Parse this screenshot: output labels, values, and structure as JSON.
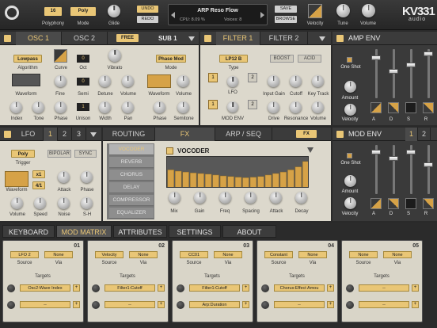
{
  "top": {
    "polyphony_label": "Polyphony",
    "polyphony_value": "16",
    "mode_label": "Mode",
    "mode_value": "Poly",
    "glide_label": "Glide",
    "undo": "UNDO",
    "redo": "REDO",
    "preset_name": "ARP Reso Flow",
    "cpu": "CPU:  8.09 %",
    "voices": "Voices: 8",
    "save": "SAVE",
    "browse": "BROWSE",
    "velocity": "Velocity",
    "tune": "Tune",
    "volume": "Volume",
    "logo": "KV331",
    "logo_sub": "audio"
  },
  "osc": {
    "tab1": "OSC 1",
    "tab2": "OSC 2",
    "free": "FREE",
    "sub": "SUB 1",
    "algorithm_value": "Lowpass",
    "algorithm": "Algorithm",
    "curve": "Curve",
    "oct": "Oct",
    "oct_value": "0",
    "vibrato": "Vibrato",
    "waveform": "Waveform",
    "fine": "Fine",
    "semi": "Semi",
    "semi_value": "0",
    "detune": "Detune",
    "volume": "Volume",
    "unison_value": "1",
    "index": "Index",
    "tone": "Tone",
    "phase": "Phase",
    "unison": "Unison",
    "width": "Width",
    "pan": "Pan",
    "sub_mode_value": "Phase Mod",
    "sub_mode": "Mode",
    "sub_waveform": "Waveform",
    "sub_volume": "Volume",
    "sub_phase": "Phase",
    "sub_semitone": "Semitone"
  },
  "filter": {
    "tab1": "FILTER 1",
    "tab2": "FILTER 2",
    "type_value": "LP12 B",
    "type": "Type",
    "boost": "BOOST",
    "acid": "ACID",
    "lfo": "LFO",
    "lfo_a": "1",
    "lfo_b": "2",
    "modenv": "MOD ENV",
    "menv_a": "1",
    "menv_b": "2",
    "input_gain": "Input Gain",
    "cutoff": "Cutoff",
    "key_track": "Key Track",
    "drive": "Drive",
    "resonance": "Resonance",
    "volume": "Volume"
  },
  "ampenv": {
    "title": "AMP ENV",
    "oneshot": "One Shot",
    "amount": "Amount",
    "velocity": "Velocity",
    "a": "A",
    "d": "D",
    "s": "S",
    "r": "R",
    "levels": [
      0.85,
      0.55,
      0.7,
      0.95
    ]
  },
  "lfo": {
    "title": "LFO",
    "t1": "1",
    "t2": "2",
    "t3": "3",
    "trigger_value": "Poly",
    "trigger": "Trigger",
    "bipolar": "BIPOLAR",
    "sync": "SYNC",
    "x1": "x1",
    "div": "4/1",
    "waveform": "Waveform",
    "attack": "Attack",
    "phase": "Phase",
    "volume": "Volume",
    "speed": "Speed",
    "noise": "Noise",
    "sh": "S-H"
  },
  "fx": {
    "routing": "ROUTING",
    "fx": "FX",
    "arp": "ARP / SEQ",
    "fx_btn": "FX",
    "items": [
      "VOCODER",
      "REVERB",
      "CHORUS",
      "DELAY",
      "COMPRESSOR",
      "EQUALIZER"
    ],
    "vocoder": "VOCODER",
    "mix": "Mix",
    "gain": "Gain",
    "freq": "Freq",
    "spacing": "Spacing",
    "attack": "Attack",
    "decay": "Decay",
    "bands": [
      0.62,
      0.58,
      0.55,
      0.52,
      0.5,
      0.48,
      0.45,
      0.42,
      0.4,
      0.38,
      0.36,
      0.38,
      0.4,
      0.45,
      0.5,
      0.55,
      0.62,
      0.72,
      0.9
    ]
  },
  "modenv": {
    "title": "MOD ENV",
    "t1": "1",
    "t2": "2",
    "oneshot": "One Shot",
    "amount": "Amount",
    "velocity": "Velocity",
    "a": "A",
    "d": "D",
    "s": "S",
    "r": "R",
    "levels": [
      0.9,
      0.75,
      0.9,
      0.6
    ]
  },
  "bottom_tabs": [
    "KEYBOARD",
    "MOD MATRIX",
    "ATTRIBUTES",
    "SETTINGS",
    "ABOUT"
  ],
  "matrix": [
    {
      "num": "01",
      "source": "LFO 2",
      "via": "None",
      "target1": "Osc2:Wave Index",
      "target2": "--"
    },
    {
      "num": "02",
      "source": "Velocity",
      "via": "None",
      "target1": "Filter1:Cutoff",
      "target2": "--"
    },
    {
      "num": "03",
      "source": "CC01",
      "via": "None",
      "target1": "Filter1:Cutoff",
      "target2": "Arp:Duration"
    },
    {
      "num": "04",
      "source": "Constant",
      "via": "None",
      "target1": "Chorus:Effect Amou",
      "target2": "--"
    },
    {
      "num": "05",
      "source": "None",
      "via": "None",
      "target1": "--",
      "target2": "--"
    }
  ],
  "matrix_labels": {
    "source": "Source",
    "via": "Via",
    "targets": "Targets"
  }
}
